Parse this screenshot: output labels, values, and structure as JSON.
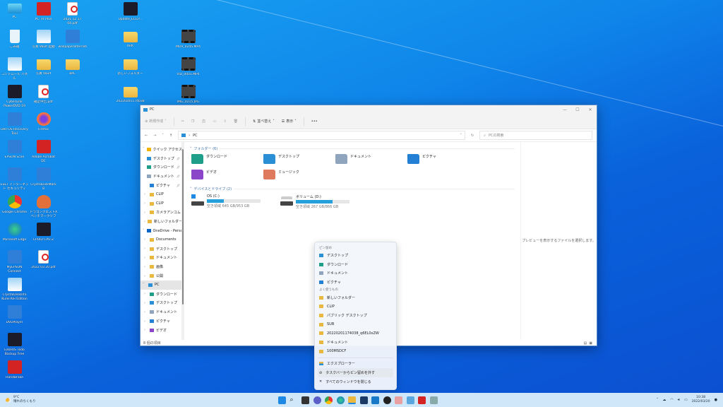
{
  "desktop": {
    "icons": [
      {
        "label": "PC",
        "icon": "monitor"
      },
      {
        "label": "ごみ箱",
        "icon": "recycle"
      },
      {
        "label": "コントロール パネル",
        "icon": "photo"
      },
      {
        "label": "CyberLink PowerDVD 19",
        "icon": "app"
      },
      {
        "label": "Dell OS Recovery Tool",
        "icon": "blue"
      },
      {
        "label": "EPSON Scan",
        "icon": "blue"
      },
      {
        "label": "ESET インターネット セキュリティ",
        "icon": "blue"
      },
      {
        "label": "Google Chrome",
        "icon": "chrome"
      },
      {
        "label": "Microsoft Edge",
        "icon": "edge"
      },
      {
        "label": "MyEPSON Connect",
        "icon": "blue"
      },
      {
        "label": "CrystalDiskInfo Kurei Kei Edition",
        "icon": "photo"
      },
      {
        "label": "DVDPlayer",
        "icon": "blue"
      },
      {
        "label": "EaseUS Todo Backup Free",
        "icon": "app"
      },
      {
        "label": "HandBrake",
        "icon": "red"
      },
      {
        "label": "PC TV Plus",
        "icon": "red"
      },
      {
        "label": "写真 Vault 起動",
        "icon": "photo"
      },
      {
        "label": "写真 Vault",
        "icon": "folder"
      },
      {
        "label": "確定申告.pdf",
        "icon": "pdf"
      },
      {
        "label": "Firefox",
        "icon": "ff"
      },
      {
        "label": "Adobe Acrobat DC",
        "icon": "red"
      },
      {
        "label": "CrystalDiskMark 8",
        "icon": "blue"
      },
      {
        "label": "ドラゴンクエストX ベンチマークソフト",
        "icon": "slime"
      },
      {
        "label": "CPUID CPU-Z",
        "icon": "app"
      },
      {
        "label": "2022 03 20.pdf",
        "icon": "pdf"
      },
      {
        "label": "2021 12 17 04.pdf",
        "icon": "pdf"
      },
      {
        "label": "wallpaperalternate...",
        "icon": "blue"
      },
      {
        "label": "BPL",
        "icon": "folder"
      },
      {
        "label": "Update_ECCP...",
        "icon": "app"
      },
      {
        "label": "ARK",
        "icon": "folder"
      },
      {
        "label": "新しいフォルダー",
        "icon": "folder"
      },
      {
        "label": "20220201174038...",
        "icon": "folder"
      },
      {
        "label": "MOV_0245.MP4",
        "icon": "video"
      },
      {
        "label": "VID_0001.MP4",
        "icon": "video"
      },
      {
        "label": "IMG_0215.JPG",
        "icon": "video"
      }
    ]
  },
  "explorer": {
    "title": "PC",
    "controls": {
      "minimize": "—",
      "maximize": "☐",
      "close": "✕"
    },
    "toolbar": {
      "new": "新規作成",
      "sort": "並べ替え",
      "view": "表示",
      "more": "•••"
    },
    "address": {
      "path": "PC",
      "search_placeholder": "PCの検索"
    },
    "nav": [
      {
        "label": "クイック アクセス",
        "icon": "star",
        "level": 0,
        "pin": false
      },
      {
        "label": "デスクトップ",
        "icon": "desktop",
        "level": 1,
        "pin": true
      },
      {
        "label": "ダウンロード",
        "icon": "download",
        "level": 1,
        "pin": true
      },
      {
        "label": "ドキュメント",
        "icon": "document",
        "level": 1,
        "pin": true
      },
      {
        "label": "ピクチャ",
        "icon": "picture",
        "level": 1,
        "pin": true
      },
      {
        "label": "CLIP",
        "icon": "folder",
        "level": 1
      },
      {
        "label": "CLIP",
        "icon": "folder",
        "level": 1
      },
      {
        "label": "カメラアンコム",
        "icon": "folder",
        "level": 1
      },
      {
        "label": "新しいフォルダー",
        "icon": "folder",
        "level": 1
      },
      {
        "label": "OneDrive - Perso",
        "icon": "cloud",
        "level": 0
      },
      {
        "label": "Documents",
        "icon": "folder",
        "level": 1
      },
      {
        "label": "デスクトップ",
        "icon": "folder",
        "level": 1
      },
      {
        "label": "ドキュメント",
        "icon": "folder",
        "level": 1
      },
      {
        "label": "画像",
        "icon": "folder",
        "level": 1
      },
      {
        "label": "公開",
        "icon": "folder",
        "level": 1
      },
      {
        "label": "PC",
        "icon": "pc",
        "level": 0,
        "selected": true
      },
      {
        "label": "ダウンロード",
        "icon": "download",
        "level": 1
      },
      {
        "label": "デスクトップ",
        "icon": "desktop",
        "level": 1
      },
      {
        "label": "ドキュメント",
        "icon": "document",
        "level": 1
      },
      {
        "label": "ピクチャ",
        "icon": "picture",
        "level": 1
      },
      {
        "label": "ビデオ",
        "icon": "video",
        "level": 1
      }
    ],
    "folders_header": "フォルダー (6)",
    "folders": [
      {
        "label": "ダウンロード",
        "color": "#1f9e8a"
      },
      {
        "label": "デスクトップ",
        "color": "#2b8fd6"
      },
      {
        "label": "ドキュメント",
        "color": "#8fa4bd"
      },
      {
        "label": "ピクチャ",
        "color": "#2380d4"
      },
      {
        "label": "ビデオ",
        "color": "#8a45c8"
      },
      {
        "label": "ミュージック",
        "color": "#e07a5f"
      }
    ],
    "drives_header": "デバイスとドライブ (2)",
    "drives": [
      {
        "label": "OS (C:)",
        "free": "空き領域 645 GB/953 GB",
        "used_pct": 32
      },
      {
        "label": "ボリューム (D:)",
        "free": "空き領域 267 GB/866 GB",
        "used_pct": 69
      }
    ],
    "preview_text": "プレビューを表示するファイルを選択します。",
    "status": "8 個の項目"
  },
  "jumplist": {
    "pinned_header": "ピン留め",
    "pinned": [
      "デスクトップ",
      "ダウンロード",
      "ドキュメント",
      "ピクチャ"
    ],
    "frequent_header": "よく使うもの",
    "frequent": [
      "新しいフォルダー",
      "CLIP",
      "パブリック デスクトップ",
      "SUB",
      "20220201174038_q6EL0xZW",
      "ドキュメント",
      "100MSDCF"
    ],
    "actions": [
      "エクスプローラー",
      "タスクバーからピン留めを外す",
      "すべてのウィンドウを閉じる"
    ]
  },
  "taskbar": {
    "weather": {
      "temp": "9°C",
      "desc": "晴れのちくもり"
    },
    "apps": [
      "start",
      "search",
      "task-view",
      "chat",
      "chrome",
      "edge",
      "file-explorer",
      "store",
      "mail",
      "settings",
      "snipping",
      "photos",
      "pc-tv",
      "app"
    ],
    "clock": {
      "time": "10:38",
      "date": "2022/03/20"
    }
  },
  "colors": {
    "accent": "#26a0da",
    "taskbar": "#cfe7f8"
  }
}
